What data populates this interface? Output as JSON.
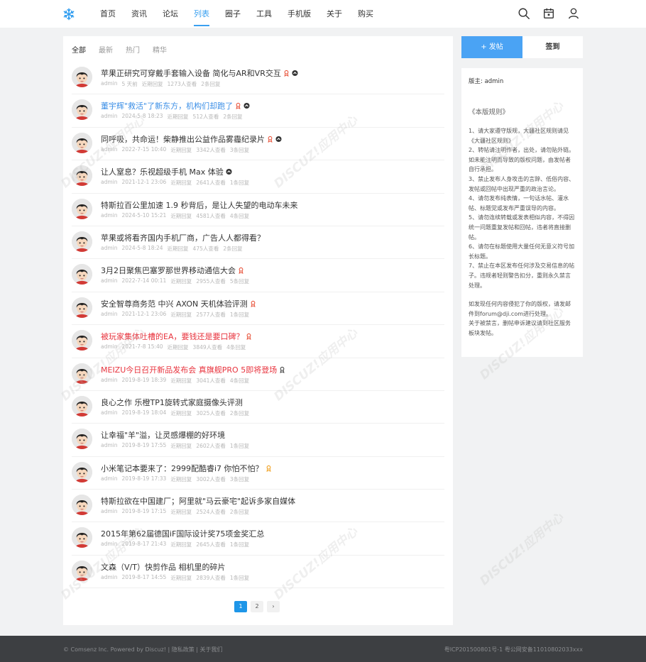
{
  "header": {
    "nav": [
      "首页",
      "资讯",
      "论坛",
      "列表",
      "圈子",
      "工具",
      "手机版",
      "关于",
      "购买"
    ],
    "active_index": 3
  },
  "tabs": [
    "全部",
    "最新",
    "热门",
    "精华"
  ],
  "threads": [
    {
      "title": "苹果正研究可穿戴手套输入设备 简化与AR和VR交互",
      "style": "",
      "icons": [
        "medal-icon",
        "hot-icon"
      ],
      "author": "admin",
      "time": "5 天前",
      "reply_label": "近期回复",
      "views": "1273人查看",
      "replies": "2条回复"
    },
    {
      "title": "董宇辉\"救活\"了新东方，机构们却跑了",
      "style": "blue",
      "icons": [
        "medal-icon",
        "hot-icon"
      ],
      "author": "admin",
      "time": "2024-5-8 18:23",
      "reply_label": "近期回复",
      "views": "512人查看",
      "replies": "2条回复"
    },
    {
      "title": "同呼吸，共命运！柴静推出公益作品雾霾纪录片",
      "style": "",
      "icons": [
        "medal-icon",
        "hot-icon"
      ],
      "author": "admin",
      "time": "2022-7-15 10:40",
      "reply_label": "近期回复",
      "views": "3342人查看",
      "replies": "3条回复"
    },
    {
      "title": "让人窒息？乐视超级手机 Max 体验",
      "style": "",
      "icons": [
        "hot-icon"
      ],
      "author": "admin",
      "time": "2021-12-1 23:06",
      "reply_label": "近期回复",
      "views": "2641人查看",
      "replies": "1条回复"
    },
    {
      "title": "特斯拉百公里加速 1.9 秒背后，是让人失望的电动车未来",
      "style": "",
      "icons": [],
      "author": "admin",
      "time": "2024-5-10 15:21",
      "reply_label": "近期回复",
      "views": "4581人查看",
      "replies": "4条回复"
    },
    {
      "title": "苹果或将看齐国内手机厂商，广告人人都得看？",
      "style": "",
      "icons": [],
      "author": "admin",
      "time": "2024-5-8 18:24",
      "reply_label": "近期回复",
      "views": "475人查看",
      "replies": "2条回复"
    },
    {
      "title": "3月2日聚焦巴塞罗那世界移动通信大会",
      "style": "",
      "icons": [
        "medal-icon"
      ],
      "author": "admin",
      "time": "2022-7-14 00:11",
      "reply_label": "近期回复",
      "views": "2955人查看",
      "replies": "5条回复"
    },
    {
      "title": "安全智尊商务范 中兴 AXON 天机体验评测",
      "style": "",
      "icons": [
        "medal-icon"
      ],
      "author": "admin",
      "time": "2021-12-1 23:06",
      "reply_label": "近期回复",
      "views": "2577人查看",
      "replies": "1条回复"
    },
    {
      "title": "被玩家集体吐槽的EA，要钱还是要口碑？",
      "style": "red",
      "icons": [
        "medal-icon"
      ],
      "author": "admin",
      "time": "2021-7-8 15:40",
      "reply_label": "近期回复",
      "views": "3849人查看",
      "replies": "4条回复"
    },
    {
      "title": "MEIZU今日召开新品发布会 真旗舰PRO 5即将登场",
      "style": "red",
      "icons": [
        "medal-dark-icon"
      ],
      "author": "admin",
      "time": "2019-8-19 18:39",
      "reply_label": "近期回复",
      "views": "3041人查看",
      "replies": "4条回复"
    },
    {
      "title": "良心之作 乐橙TP1旋转式家庭摄像头评测",
      "style": "",
      "icons": [],
      "author": "admin",
      "time": "2019-8-19 18:04",
      "reply_label": "近期回复",
      "views": "3025人查看",
      "replies": "2条回复"
    },
    {
      "title": "让幸福\"羊\"溢，让灵感爆棚的好环境",
      "style": "",
      "icons": [],
      "author": "admin",
      "time": "2019-8-19 17:55",
      "reply_label": "近期回复",
      "views": "2602人查看",
      "replies": "1条回复"
    },
    {
      "title": "小米笔记本要来了：2999配酷睿i7 你怕不怕？",
      "style": "",
      "icons": [
        "medal-gold-icon"
      ],
      "author": "admin",
      "time": "2019-8-19 17:33",
      "reply_label": "近期回复",
      "views": "3002人查看",
      "replies": "3条回复"
    },
    {
      "title": "特斯拉欲在中国建厂；阿里就\"马云豪宅\"起诉多家自媒体",
      "style": "",
      "icons": [],
      "author": "admin",
      "time": "2019-8-19 17:15",
      "reply_label": "近期回复",
      "views": "2524人查看",
      "replies": "2条回复"
    },
    {
      "title": "2015年第62届德国iF国际设计奖75项金奖汇总",
      "style": "",
      "icons": [],
      "author": "admin",
      "time": "2019-8-17 21:43",
      "reply_label": "近期回复",
      "views": "2645人查看",
      "replies": "1条回复"
    },
    {
      "title": "文森（V/T）快剪作品 相机里的碎片",
      "style": "",
      "icons": [],
      "author": "admin",
      "time": "2019-8-17 14:55",
      "reply_label": "近期回复",
      "views": "2839人查看",
      "replies": "1条回复"
    }
  ],
  "pager": {
    "pages": [
      "1",
      "2"
    ],
    "next": "›"
  },
  "sidebar": {
    "post_label": "+ 发帖",
    "sign_label": "签到",
    "moderator_label": "版主:",
    "moderator": "admin",
    "rules_title": "《本版规则》",
    "rules": [
      "1、请大家遵守版规，大疆社区规则请见《大疆社区规则》",
      "2、转帖请注明作者，出处，请勿贴外链。如未能注明而导致的版权问题，由发帖者自行承担。",
      "3、禁止发布人身攻击的言辞、低俗内容、发帖或回帖中出现严重的政治言论。",
      "4、请勿发布纯表情，一句话水帖、灌水帖、标题党或发布严重误导的内容。",
      "5、请勿连续转载或发表相似内容，不得因统一问题重复发帖和回帖，违者将直接删帖。",
      "6、请勿在标题使用大量任何无意义符号加长标题。",
      "7、禁止在本区发布任何涉及交易信息的帖子。违规者轻则警告扣分，重则永久禁言处理。"
    ],
    "notes": [
      "如发现任何内容侵犯了你的版权，请发邮件到forum@dji.com进行处理。",
      "关于被禁言，删帖申诉建议请到社区服务板块发帖。"
    ]
  },
  "footer": {
    "left": "© Comsenz Inc. Powered by Discuz!  |  隐私政策  |  关于我们",
    "right": "粤ICP201500801号-1    粤公网安备11010802033xxx"
  },
  "colors": {
    "accent": "#3aa0f0",
    "title_blue": "#3a8ee6",
    "title_red": "#e8333d",
    "footer": "#3d3f42"
  }
}
